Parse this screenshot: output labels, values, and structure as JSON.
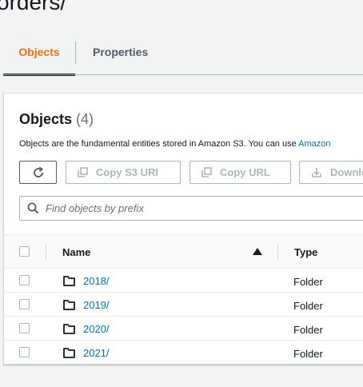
{
  "page": {
    "heading": "orders/"
  },
  "tabs": [
    {
      "label": "Objects",
      "active": true
    },
    {
      "label": "Properties",
      "active": false
    }
  ],
  "colors": {
    "accent": "#ec7211",
    "link": "#0073bb",
    "text": "#16191f",
    "muted": "#687078",
    "disabled": "#aab7b8"
  },
  "objects_panel": {
    "title": "Objects",
    "count": "(4)",
    "description": "Objects are the fundamental entities stored in Amazon S3. You can use ",
    "description_link": "Amazon",
    "buttons": {
      "refresh_icon": "refresh-icon",
      "copy_s3_uri": "Copy S3 URI",
      "copy_url": "Copy URL",
      "download": "Download"
    },
    "search": {
      "placeholder": "Find objects by prefix",
      "value": "",
      "icon": "search-icon"
    },
    "table": {
      "columns": {
        "name": "Name",
        "type": "Type"
      },
      "sort": {
        "column": "Name",
        "direction": "ascending"
      },
      "rows": [
        {
          "name": "2018/",
          "type": "Folder",
          "icon": "folder-icon"
        },
        {
          "name": "2019/",
          "type": "Folder",
          "icon": "folder-icon"
        },
        {
          "name": "2020/",
          "type": "Folder",
          "icon": "folder-icon"
        },
        {
          "name": "2021/",
          "type": "Folder",
          "icon": "folder-icon"
        }
      ]
    }
  }
}
